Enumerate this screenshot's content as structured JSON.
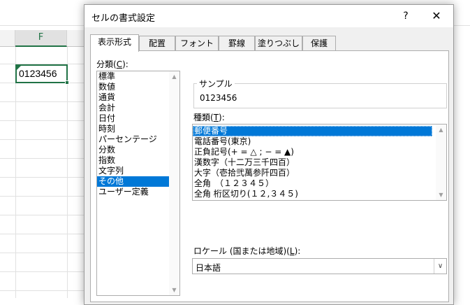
{
  "sheet": {
    "column_header": "F",
    "active_cell_value": "0123456"
  },
  "dialog": {
    "title": "セルの書式設定",
    "help": "?",
    "close": "✕",
    "tabs": [
      "表示形式",
      "配置",
      "フォント",
      "罫線",
      "塗りつぶし",
      "保護"
    ],
    "category_label": "分類(",
    "category_label_key": "C",
    "category_label_end": "):",
    "categories": [
      "標準",
      "数値",
      "通貨",
      "会計",
      "日付",
      "時刻",
      "パーセンテージ",
      "分数",
      "指数",
      "文字列",
      "その他",
      "ユーザー定義"
    ],
    "sample_title": "サンプル",
    "sample_value": "0123456",
    "type_label": "種類(",
    "type_label_key": "T",
    "type_label_end": "):",
    "types": [
      "郵便番号",
      "電話番号(東京)",
      "正負記号(+ = △ ; − = ▲)",
      "漢数字（十二万三千四百）",
      "大字（壱拾弐萬参阡四百）",
      "全角　（１２３４５）",
      "全角 桁区切り(１２,３４５)"
    ],
    "locale_label": "ロケール (国または地域)(",
    "locale_label_key": "L",
    "locale_label_end": "):",
    "locale_value": "日本語"
  },
  "colors": {
    "selection": "#0078d7",
    "excel_green": "#217346"
  }
}
